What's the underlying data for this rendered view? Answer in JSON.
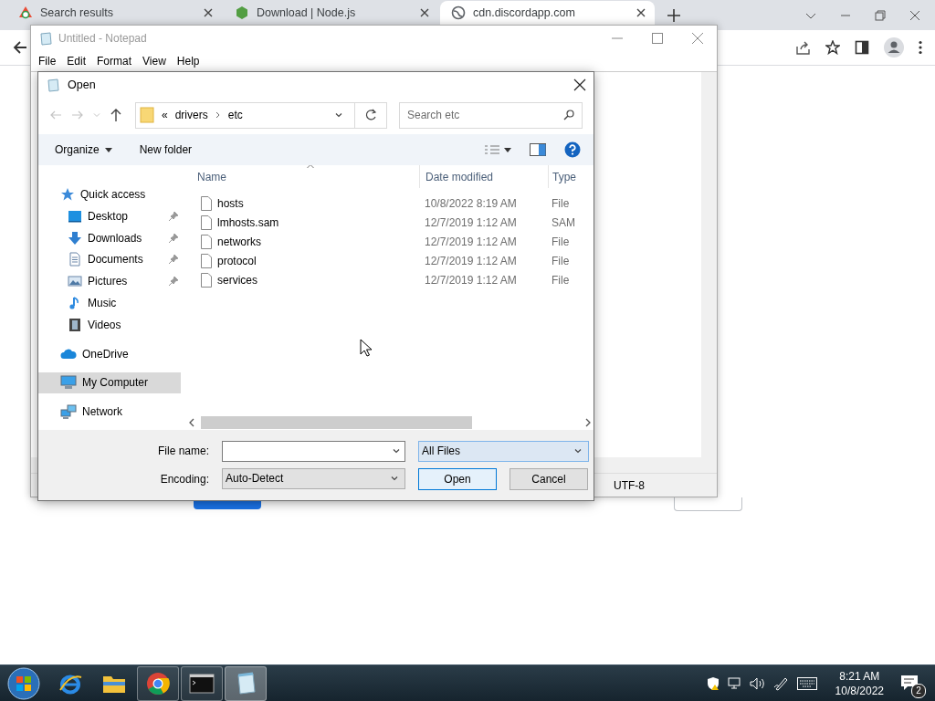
{
  "browser": {
    "tabs": [
      {
        "title": "Search results",
        "kind": "search",
        "selected": false
      },
      {
        "title": "Download | Node.js",
        "kind": "hexagon",
        "selected": false
      },
      {
        "title": "cdn.discordapp.com",
        "kind": "globe",
        "selected": true
      }
    ]
  },
  "notepad": {
    "title": "Untitled - Notepad",
    "menu": [
      "File",
      "Edit",
      "Format",
      "View",
      "Help"
    ],
    "encoding": "UTF-8"
  },
  "open_dialog": {
    "title": "Open",
    "path_prefix": "«",
    "path": [
      "drivers",
      "etc"
    ],
    "search": {
      "placeholder": "Search etc"
    },
    "commands": {
      "organize": "Organize",
      "new_folder": "New folder"
    },
    "sidebar": {
      "items": [
        {
          "label": "Quick access",
          "kind": "star",
          "selected": false,
          "children": [
            {
              "label": "Desktop",
              "kind": "desktop",
              "selected": false,
              "pinned": true
            },
            {
              "label": "Downloads",
              "kind": "download",
              "selected": false,
              "pinned": true
            },
            {
              "label": "Documents",
              "kind": "document",
              "selected": false,
              "pinned": true
            },
            {
              "label": "Pictures",
              "kind": "picture",
              "selected": false,
              "pinned": true
            },
            {
              "label": "Music",
              "kind": "music",
              "selected": false,
              "pinned": false
            },
            {
              "label": "Videos",
              "kind": "video",
              "selected": false,
              "pinned": false
            }
          ]
        },
        {
          "label": "OneDrive",
          "kind": "cloud",
          "selected": false
        },
        {
          "label": "My Computer",
          "kind": "computer",
          "selected": true
        },
        {
          "label": "Network",
          "kind": "network",
          "selected": false
        }
      ]
    },
    "table": {
      "columns": [
        "Name",
        "Date modified",
        "Type"
      ],
      "rows": [
        {
          "name": "hosts",
          "date": "10/8/2022 8:19 AM",
          "type": "File"
        },
        {
          "name": "lmhosts.sam",
          "date": "12/7/2019 1:12 AM",
          "type": "SAM"
        },
        {
          "name": "networks",
          "date": "12/7/2019 1:12 AM",
          "type": "File"
        },
        {
          "name": "protocol",
          "date": "12/7/2019 1:12 AM",
          "type": "File"
        },
        {
          "name": "services",
          "date": "12/7/2019 1:12 AM",
          "type": "File"
        }
      ]
    },
    "file_name_label": "File name:",
    "file_type": "All Files",
    "encoding_label": "Encoding:",
    "encoding": "Auto-Detect",
    "buttons": [
      "Open",
      "Cancel"
    ]
  },
  "taskbar": {
    "apps": [
      {
        "kind": "ie",
        "running": false,
        "selected": false
      },
      {
        "kind": "folder",
        "running": false,
        "selected": false
      },
      {
        "kind": "chrome",
        "running": true,
        "selected": false
      },
      {
        "kind": "console",
        "running": true,
        "selected": false
      },
      {
        "kind": "notepad",
        "running": true,
        "selected": true
      }
    ],
    "time": "8:21 AM",
    "date": "10/8/2022",
    "notifications": "2"
  }
}
